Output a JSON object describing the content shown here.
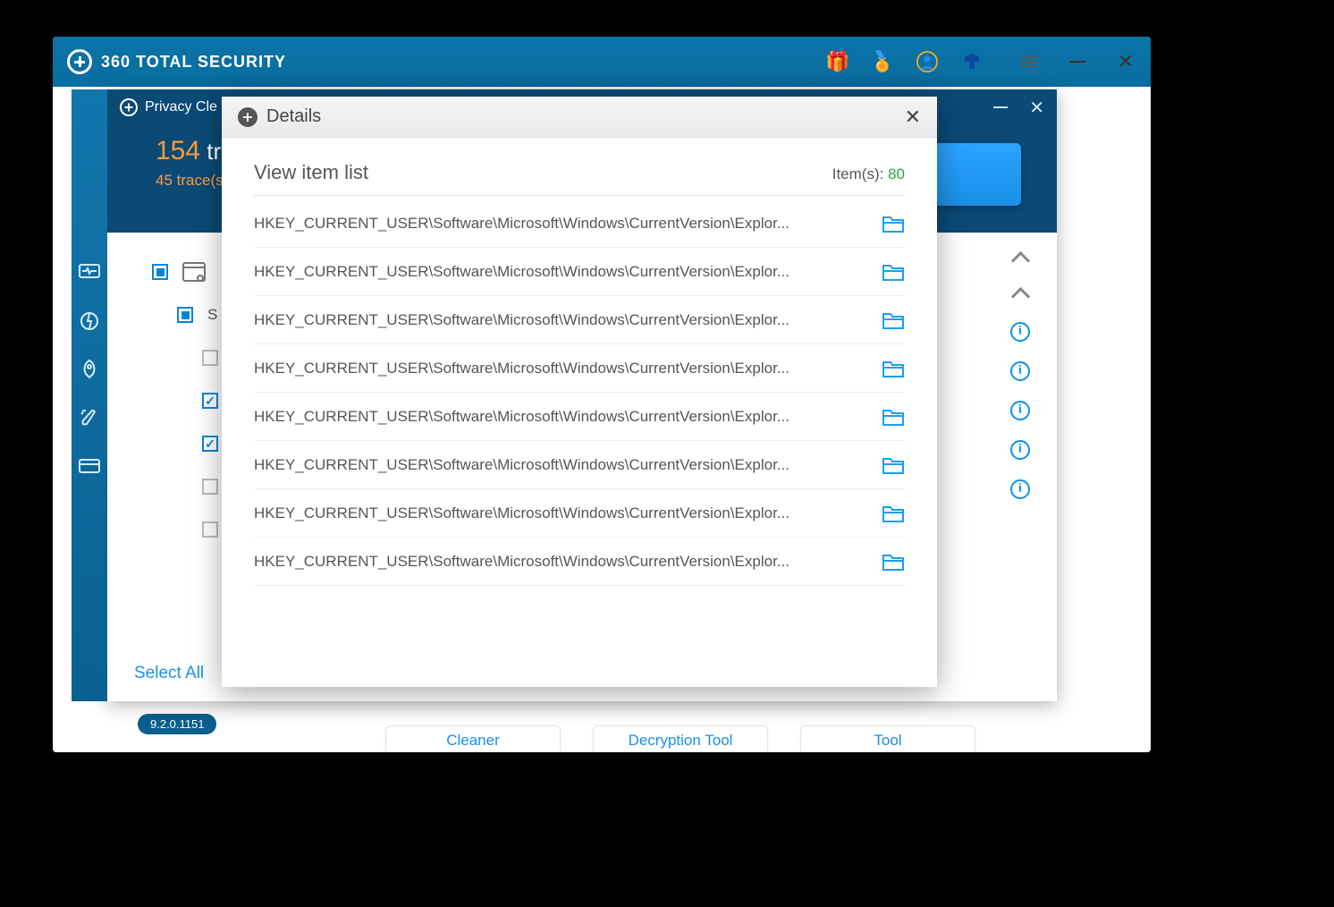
{
  "app": {
    "name": "360 TOTAL SECURITY",
    "version": "9.2.0.1151"
  },
  "privacy": {
    "title": "Privacy Cle",
    "count": "154",
    "countLabel": "tra",
    "subcount": "45",
    "subLabel": "trace(s)",
    "selectAll": "Select All"
  },
  "details": {
    "title": "Details",
    "subtitle": "View item list",
    "itemsLabel": "Item(s):",
    "itemsCount": "80",
    "rows": [
      "HKEY_CURRENT_USER\\Software\\Microsoft\\Windows\\CurrentVersion\\Explor...",
      "HKEY_CURRENT_USER\\Software\\Microsoft\\Windows\\CurrentVersion\\Explor...",
      "HKEY_CURRENT_USER\\Software\\Microsoft\\Windows\\CurrentVersion\\Explor...",
      "HKEY_CURRENT_USER\\Software\\Microsoft\\Windows\\CurrentVersion\\Explor...",
      "HKEY_CURRENT_USER\\Software\\Microsoft\\Windows\\CurrentVersion\\Explor...",
      "HKEY_CURRENT_USER\\Software\\Microsoft\\Windows\\CurrentVersion\\Explor...",
      "HKEY_CURRENT_USER\\Software\\Microsoft\\Windows\\CurrentVersion\\Explor...",
      "HKEY_CURRENT_USER\\Software\\Microsoft\\Windows\\CurrentVersion\\Explor..."
    ]
  },
  "peek": {
    "b1": "Cleaner",
    "b2": "Decryption Tool",
    "b3": "Tool"
  },
  "accent": "#1a8fe8"
}
